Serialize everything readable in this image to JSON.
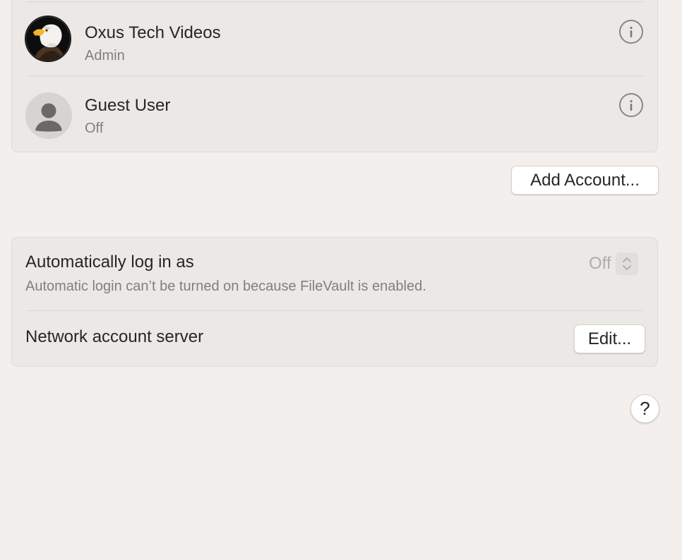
{
  "users": [
    {
      "name": "Oxus Tech Videos",
      "role": "Admin",
      "avatar_icon": "eagle-avatar"
    },
    {
      "name": "Guest User",
      "role": "Off",
      "avatar_icon": "person-silhouette-avatar"
    }
  ],
  "info_icon": "info-circle-icon",
  "add_account_label": "Add Account...",
  "auto_login": {
    "label": "Automatically log in as",
    "description": "Automatic login can’t be turned on because FileVault is enabled.",
    "value": "Off",
    "enabled": false
  },
  "network_server": {
    "label": "Network account server",
    "edit_label": "Edit..."
  },
  "help_label": "?",
  "colors": {
    "window_background": "#f2efec",
    "group_background": "#ece8e5",
    "secondary_text": "#808080",
    "disabled_text": "#b0acaa"
  }
}
